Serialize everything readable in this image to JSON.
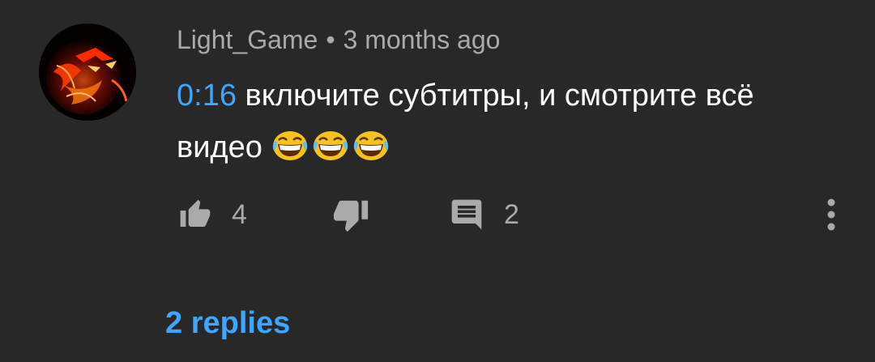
{
  "comment": {
    "author": "Light_Game",
    "separator": "•",
    "time": "3 months ago",
    "timestamp_link": "0:16",
    "text": " включите субтитры, и смотрите всё видео ",
    "emoji_icon": "tears-of-joy-emoji",
    "emoji_count": 3
  },
  "actions": {
    "like_icon": "thumbs-up-icon",
    "like_count": "4",
    "dislike_icon": "thumbs-down-icon",
    "reply_icon": "comment-icon",
    "reply_count": "2",
    "more_icon": "more-vert-icon"
  },
  "replies_label": "2 replies",
  "colors": {
    "background": "#282828",
    "link": "#3ea6ff",
    "secondary_text": "#aaaaaa",
    "primary_text": "#ffffff"
  }
}
